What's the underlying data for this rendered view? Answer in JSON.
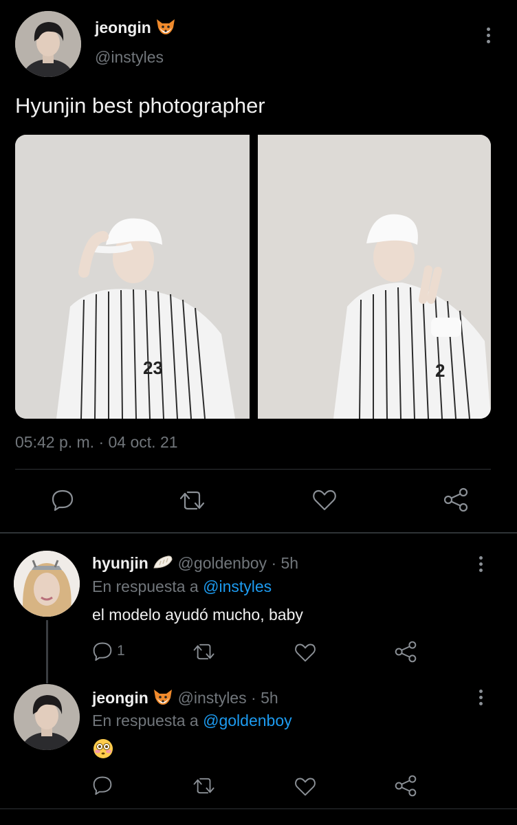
{
  "main_tweet": {
    "display_name": "jeongin",
    "name_emoji": "fox-face-emoji",
    "handle": "@instyles",
    "text": "Hyunjin best photographer",
    "timestamp": "05:42 p. m. · 04 oct. 21",
    "actions": [
      "reply-icon",
      "retweet-icon",
      "like-icon",
      "share-icon"
    ]
  },
  "replies": [
    {
      "display_name": "hyunjin",
      "name_emoji": "dumpling-emoji",
      "handle": "@goldenboy",
      "separator": "·",
      "time": "5h",
      "replying_prefix": "En respuesta a",
      "replying_to": "@instyles",
      "text": "el modelo ayudó mucho, baby",
      "reply_count": "1"
    },
    {
      "display_name": "jeongin",
      "name_emoji": "fox-face-emoji",
      "handle": "@instyles",
      "separator": "·",
      "time": "5h",
      "replying_prefix": "En respuesta a",
      "replying_to": "@goldenboy",
      "text_emoji": "flushed-face-emoji"
    }
  ],
  "colors": {
    "background": "#000000",
    "text": "#e7e9ea",
    "secondary": "#71767b",
    "link": "#1d9bf0",
    "divider": "#2f3336"
  }
}
